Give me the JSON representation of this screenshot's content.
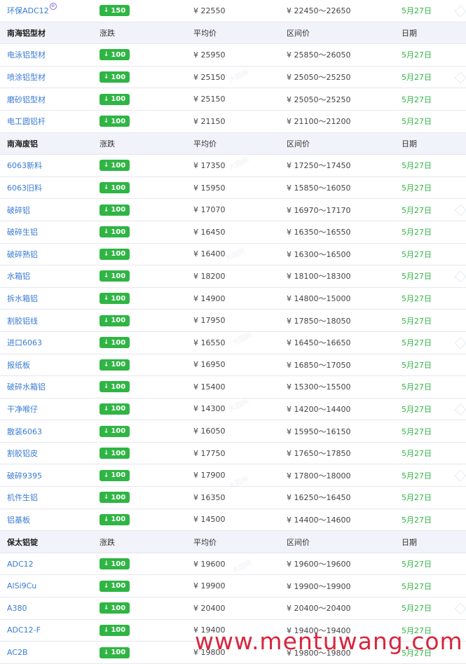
{
  "rows": [
    {
      "kind": "item",
      "name": "环保ADC12",
      "tag": "⊕",
      "change": "150",
      "avg": "¥ 22550",
      "range": "¥ 22450～22650",
      "date": "5月27日"
    },
    {
      "kind": "header",
      "name": "南海铝型材",
      "change": "涨跌",
      "avg": "平均价",
      "range": "区间价",
      "date": "日期"
    },
    {
      "kind": "item",
      "name": "电泳铝型材",
      "change": "100",
      "avg": "¥ 25950",
      "range": "¥ 25850～26050",
      "date": "5月27日"
    },
    {
      "kind": "item",
      "name": "喷涂铝型材",
      "change": "100",
      "avg": "¥ 25150",
      "range": "¥ 25050～25250",
      "date": "5月27日"
    },
    {
      "kind": "item",
      "name": "磨砂铝型材",
      "change": "100",
      "avg": "¥ 25150",
      "range": "¥ 25050～25250",
      "date": "5月27日"
    },
    {
      "kind": "item",
      "name": "电工圆铝杆",
      "change": "100",
      "avg": "¥ 21150",
      "range": "¥ 21100～21200",
      "date": "5月27日"
    },
    {
      "kind": "header",
      "name": "南海废铝",
      "change": "涨跌",
      "avg": "平均价",
      "range": "区间价",
      "date": "日期"
    },
    {
      "kind": "item",
      "name": "6063新料",
      "change": "100",
      "avg": "¥ 17350",
      "range": "¥ 17250～17450",
      "date": "5月27日"
    },
    {
      "kind": "item",
      "name": "6063旧料",
      "change": "100",
      "avg": "¥ 15950",
      "range": "¥ 15850～16050",
      "date": "5月27日"
    },
    {
      "kind": "item",
      "name": "破碎铝",
      "change": "100",
      "avg": "¥ 17070",
      "range": "¥ 16970～17170",
      "date": "5月27日"
    },
    {
      "kind": "item",
      "name": "破碎生铝",
      "change": "100",
      "avg": "¥ 16450",
      "range": "¥ 16350～16550",
      "date": "5月27日"
    },
    {
      "kind": "item",
      "name": "破碎熟铝",
      "change": "100",
      "avg": "¥ 16400",
      "range": "¥ 16300～16500",
      "date": "5月27日"
    },
    {
      "kind": "item",
      "name": "水箱铝",
      "change": "100",
      "avg": "¥ 18200",
      "range": "¥ 18100～18300",
      "date": "5月27日"
    },
    {
      "kind": "item",
      "name": "拆水箱铝",
      "change": "100",
      "avg": "¥ 14900",
      "range": "¥ 14800～15000",
      "date": "5月27日"
    },
    {
      "kind": "item",
      "name": "割胶铝线",
      "change": "100",
      "avg": "¥ 17950",
      "range": "¥ 17850～18050",
      "date": "5月27日"
    },
    {
      "kind": "item",
      "name": "进口6063",
      "change": "100",
      "avg": "¥ 16550",
      "range": "¥ 16450～16650",
      "date": "5月27日"
    },
    {
      "kind": "item",
      "name": "报纸板",
      "change": "100",
      "avg": "¥ 16950",
      "range": "¥ 16850～17050",
      "date": "5月27日"
    },
    {
      "kind": "item",
      "name": "破碎水箱铝",
      "change": "100",
      "avg": "¥ 15400",
      "range": "¥ 15300～15500",
      "date": "5月27日"
    },
    {
      "kind": "item",
      "name": "干净喉仔",
      "change": "100",
      "avg": "¥ 14300",
      "range": "¥ 14200～14400",
      "date": "5月27日"
    },
    {
      "kind": "item",
      "name": "散装6063",
      "change": "100",
      "avg": "¥ 16050",
      "range": "¥ 15950～16150",
      "date": "5月27日"
    },
    {
      "kind": "item",
      "name": "割胶铝皮",
      "change": "100",
      "avg": "¥ 17750",
      "range": "¥ 17650～17850",
      "date": "5月27日"
    },
    {
      "kind": "item",
      "name": "破碎9395",
      "change": "100",
      "avg": "¥ 17900",
      "range": "¥ 17800～18000",
      "date": "5月27日"
    },
    {
      "kind": "item",
      "name": "机件生铝",
      "change": "100",
      "avg": "¥ 16350",
      "range": "¥ 16250～16450",
      "date": "5月27日"
    },
    {
      "kind": "item",
      "name": "铝基板",
      "change": "100",
      "avg": "¥ 14500",
      "range": "¥ 14400～14600",
      "date": "5月27日"
    },
    {
      "kind": "header",
      "name": "保太铝锭",
      "change": "涨跌",
      "avg": "平均价",
      "range": "区间价",
      "date": "日期"
    },
    {
      "kind": "item",
      "name": "ADC12",
      "change": "100",
      "avg": "¥ 19600",
      "range": "¥ 19600～19600",
      "date": "5月27日"
    },
    {
      "kind": "item",
      "name": "AlSi9Cu",
      "change": "100",
      "avg": "¥ 19900",
      "range": "¥ 19900～19900",
      "date": "5月27日"
    },
    {
      "kind": "item",
      "name": "A380",
      "change": "100",
      "avg": "¥ 20400",
      "range": "¥ 20400～20400",
      "date": "5月27日"
    },
    {
      "kind": "item",
      "name": "ADC12-F",
      "change": "100",
      "avg": "¥ 19400",
      "range": "¥ 19400～19400",
      "date": "5月27日"
    },
    {
      "kind": "item",
      "name": "AC2B",
      "change": "100",
      "avg": "¥ 19800",
      "range": "¥ 19800～19800",
      "date": "5月27日"
    }
  ],
  "arrow_glyph": "↓",
  "watermark_text": "大圆网",
  "site_watermark": "www.mentuwang.com",
  "colors": {
    "badge": "#2fb544",
    "link": "#3a7bd5",
    "date": "#2fb544",
    "header_bg": "#f2f2fa"
  }
}
